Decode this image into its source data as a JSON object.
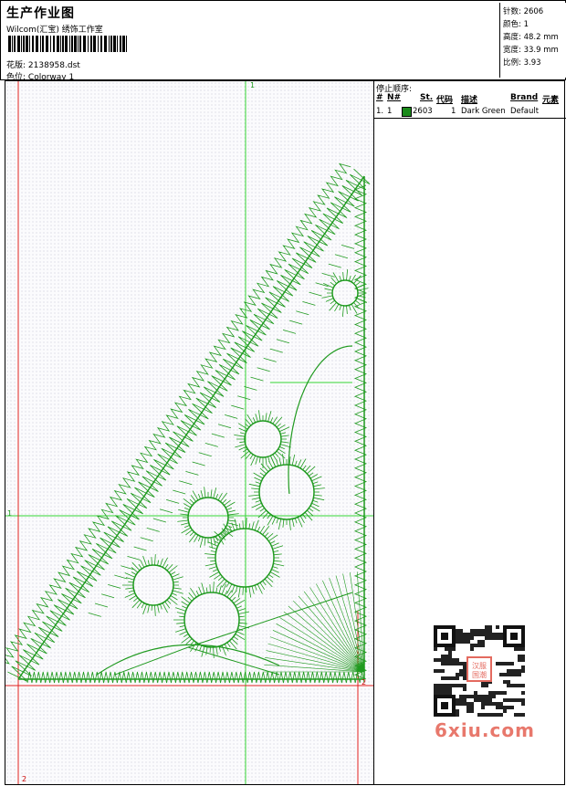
{
  "header": {
    "title": "生产作业图",
    "company": "Wilcom(汇宝) 绣饰工作室",
    "design_label": "花版:",
    "design_file": "2138958.dst",
    "colorway_label": "色位:",
    "colorway": "Colorway 1"
  },
  "stats": {
    "stitches_label": "针数:",
    "stitches": "2606",
    "colors_label": "颜色:",
    "colors": "1",
    "height_label": "高度:",
    "height": "48.2 mm",
    "width_label": "宽度:",
    "width": "33.9 mm",
    "scale_label": "比例:",
    "scale": "3.93"
  },
  "stop_sequence": {
    "title": "停止顺序:",
    "columns": [
      "#",
      "N#",
      "St.",
      "代码",
      "描述",
      "Brand",
      "元素"
    ],
    "rows": [
      {
        "num": "1.",
        "needle": "1",
        "stitches": "2603",
        "code": "1",
        "description": "Dark Green",
        "brand": "Default",
        "color": "#1a8a1a"
      }
    ]
  },
  "guides": {
    "v_top_label": "1",
    "h_left_label": "1",
    "corner_right_label": "2",
    "corner_bottom_label": "2"
  },
  "colors": {
    "thread": "#1f9a1f",
    "guide_green": "#33d633",
    "guide_red": "#e02020"
  },
  "watermark": {
    "text": "6xiu.com",
    "qr_label": "汉服国潮"
  }
}
